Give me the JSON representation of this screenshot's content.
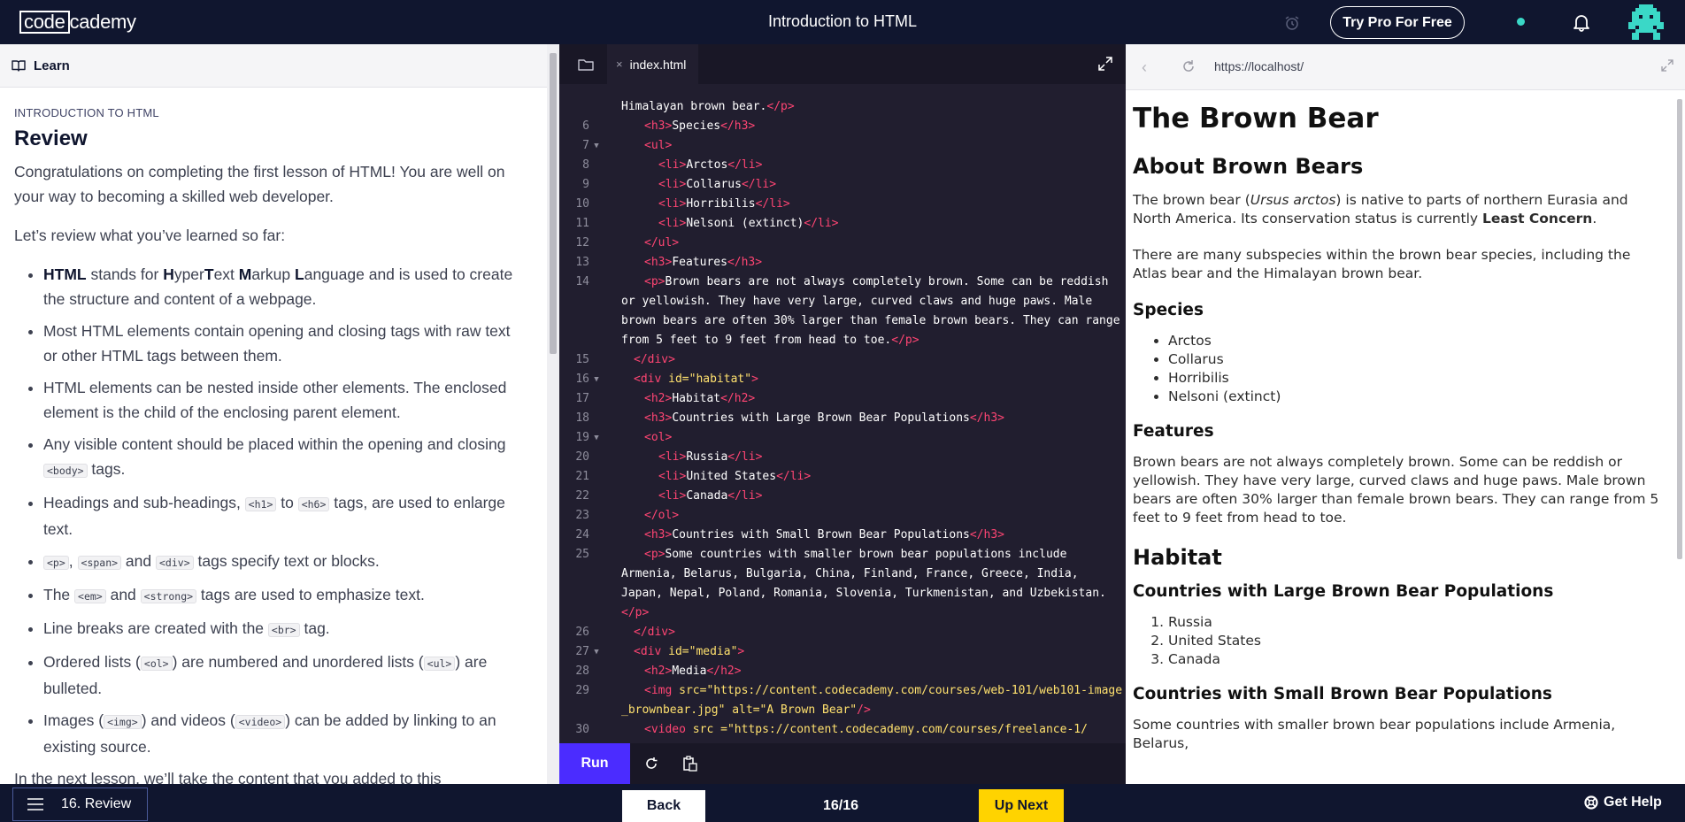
{
  "topnav": {
    "logo_left": "code",
    "logo_right": "cademy",
    "title": "Introduction to HTML",
    "pro_button": "Try Pro For Free",
    "status_dot_color": "#3ad8c7"
  },
  "learn": {
    "header_label": "Learn",
    "course_label": "INTRODUCTION TO HTML",
    "heading": "Review",
    "intro": "Congratulations on completing the first lesson of HTML! You are well on your way to becoming a skilled web developer.",
    "review_intro": "Let’s review what you’ve learned so far:",
    "b1": {
      "t1": "HTML",
      "t2": " stands for ",
      "t3": "H",
      "t4": "yper",
      "t5": "T",
      "t6": "ext ",
      "t7": "M",
      "t8": "arkup ",
      "t9": "L",
      "t10": "anguage and is used to create the structure and content of a webpage."
    },
    "b2": "Most HTML elements contain opening and closing tags with raw text or other HTML tags between them.",
    "b3": "HTML elements can be nested inside other elements. The enclosed element is the child of the enclosing parent element.",
    "b4": {
      "t1": "Any visible content should be placed within the opening and closing ",
      "c1": "<body>",
      "t2": " tags."
    },
    "b5": {
      "t1": "Headings and sub-headings, ",
      "c1": "<h1>",
      "t2": " to ",
      "c2": "<h6>",
      "t3": " tags, are used to enlarge text."
    },
    "b6": {
      "c1": "<p>",
      "t1": ", ",
      "c2": "<span>",
      "t2": " and ",
      "c3": "<div>",
      "t3": " tags specify text or blocks."
    },
    "b7": {
      "t1": "The ",
      "c1": "<em>",
      "t2": " and ",
      "c2": "<strong>",
      "t3": " tags are used to emphasize text."
    },
    "b8": {
      "t1": "Line breaks are created with the ",
      "c1": "<br>",
      "t2": " tag."
    },
    "b9": {
      "t1": "Ordered lists (",
      "c1": "<ol>",
      "t2": ") are numbered and unordered lists (",
      "c2": "<ul>",
      "t3": ") are bulleted."
    },
    "b10": {
      "t1": "Images (",
      "c1": "<img>",
      "t2": ") and videos (",
      "c2": "<video>",
      "t3": ") can be added by linking to an existing source."
    },
    "next_line": "In the next lesson, we’ll take the content that you added to this"
  },
  "editor": {
    "tab_close": "×",
    "tab_name": "index.html",
    "run": "Run",
    "lines": {
      "l5a": "Himalayan brown bear.",
      "l5b": "</p>",
      "l6": {
        "n": "6",
        "o": "<h3>",
        "t": "Species",
        "c": "</h3>"
      },
      "l7": {
        "n": "7",
        "o": "<ul>"
      },
      "l8": {
        "n": "8",
        "o": "<li>",
        "t": "Arctos",
        "c": "</li>"
      },
      "l9": {
        "n": "9",
        "o": "<li>",
        "t": "Collarus",
        "c": "</li>"
      },
      "l10": {
        "n": "10",
        "o": "<li>",
        "t": "Horribilis",
        "c": "</li>"
      },
      "l11": {
        "n": "11",
        "o": "<li>",
        "t": "Nelsoni (extinct)",
        "c": "</li>"
      },
      "l12": {
        "n": "12",
        "c": "</ul>"
      },
      "l13": {
        "n": "13",
        "o": "<h3>",
        "t": "Features",
        "c": "</h3>"
      },
      "l14": {
        "n": "14",
        "o": "<p>",
        "t": "Brown bears are not always completely brown. Some can be reddish or yellowish. They have very large, curved claws and huge paws. Male brown bears are often 30% larger than female brown bears. They can range from 5 feet to 9 feet from head to toe.",
        "c": "</p>"
      },
      "l15": {
        "n": "15",
        "c": "</div>"
      },
      "l16": {
        "n": "16",
        "o": "<div ",
        "a": "id=",
        "s": "\"habitat\"",
        "e": ">"
      },
      "l17": {
        "n": "17",
        "o": "<h2>",
        "t": "Habitat",
        "c": "</h2>"
      },
      "l18": {
        "n": "18",
        "o": "<h3>",
        "t": "Countries with Large Brown Bear Populations",
        "c": "</h3>"
      },
      "l19": {
        "n": "19",
        "o": "<ol>"
      },
      "l20": {
        "n": "20",
        "o": "<li>",
        "t": "Russia",
        "c": "</li>"
      },
      "l21": {
        "n": "21",
        "o": "<li>",
        "t": "United States",
        "c": "</li>"
      },
      "l22": {
        "n": "22",
        "o": "<li>",
        "t": "Canada",
        "c": "</li>"
      },
      "l23": {
        "n": "23",
        "c": "</ol>"
      },
      "l24": {
        "n": "24",
        "o": "<h3>",
        "t": "Countries with Small Brown Bear Populations",
        "c": "</h3>"
      },
      "l25": {
        "n": "25",
        "o": "<p>",
        "t": "Some countries with smaller brown bear populations include Armenia, Belarus, Bulgaria, China, Finland, France, Greece, India, Japan, Nepal, Poland, Romania, Slovenia, Turkmenistan, and Uzbekistan.",
        "c": "</p>"
      },
      "l26": {
        "n": "26",
        "c": "</div>"
      },
      "l27": {
        "n": "27",
        "o": "<div ",
        "a": "id=",
        "s": "\"media\"",
        "e": ">"
      },
      "l28": {
        "n": "28",
        "o": "<h2>",
        "t": "Media",
        "c": "</h2>"
      },
      "l29": {
        "n": "29",
        "o": "<img ",
        "a1": "src=",
        "s1": "\"https://content.codecademy.com/courses/web-101/web101-image_brownbear.jpg\"",
        "a2": " alt=",
        "s2": "\"A Brown Bear\"",
        "e": "/>"
      },
      "l30": {
        "n": "30",
        "o": "<video ",
        "a": "src =",
        "s": "\"https://content.codecademy.com/courses/freelance-1/"
      }
    }
  },
  "browser": {
    "url": "https://localhost/",
    "h1": "The Brown Bear",
    "about_h2": "About Brown Bears",
    "about_p1": {
      "t1": "The brown bear (",
      "em": "Ursus arctos",
      "t2": ") is native to parts of northern Eurasia and North America. Its conservation status is currently ",
      "strong": "Least Concern",
      "t3": "."
    },
    "about_p2": "There are many subspecies within the brown bear species, including the Atlas bear and the Himalayan brown bear.",
    "species_h3": "Species",
    "species": [
      "Arctos",
      "Collarus",
      "Horribilis",
      "Nelsoni (extinct)"
    ],
    "features_h3": "Features",
    "features_p": "Brown bears are not always completely brown. Some can be reddish or yellowish. They have very large, curved claws and huge paws. Male brown bears are often 30% larger than female brown bears. They can range from 5 feet to 9 feet from head to toe.",
    "habitat_h2": "Habitat",
    "large_h3": "Countries with Large Brown Bear Populations",
    "large": [
      "Russia",
      "United States",
      "Canada"
    ],
    "small_h3": "Countries with Small Brown Bear Populations",
    "small_p": "Some countries with smaller brown bear populations include Armenia, Belarus,"
  },
  "bottombar": {
    "lesson": "16. Review",
    "back": "Back",
    "progress": "16/16",
    "up_next": "Up Next",
    "help": "Get Help"
  }
}
